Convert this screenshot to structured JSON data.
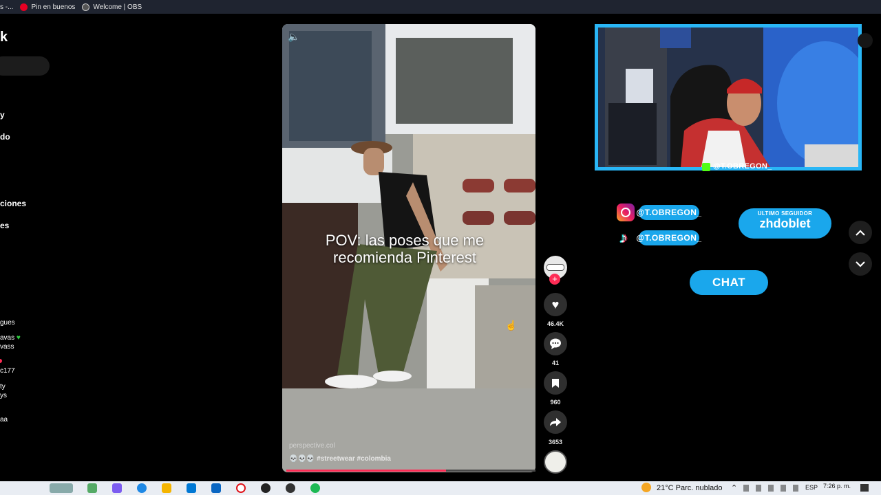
{
  "bookmarks": [
    {
      "label": "s -...",
      "icon": "tab-fragment-icon"
    },
    {
      "label": "Pin en buenos",
      "icon": "pinterest-icon"
    },
    {
      "label": "Welcome | OBS",
      "icon": "obs-icon"
    }
  ],
  "sidebar": {
    "logo_fragment": "k",
    "items": [
      "y",
      "do",
      "ciones",
      "es"
    ],
    "following": [
      "gues",
      "avas",
      "vass",
      "c177",
      "ty",
      "ys",
      "aa"
    ]
  },
  "video": {
    "caption_line1": "POV: las poses que me",
    "caption_line2": "recomienda Pinterest",
    "author": "perspective.col",
    "hashtags": "💀💀💀 #streetwear #colombia",
    "progress": 0.64
  },
  "actions": {
    "likes": "46.4K",
    "comments": "41",
    "saves": "960",
    "shares": "3653"
  },
  "stream": {
    "cam_handle": "@T.OBREGON_",
    "instagram_handle": "@T.OBREGON_",
    "tiktok_handle": "@T.OBREGON_",
    "follower_title": "ULTIMO SEGUIDOR",
    "follower_name": "zhdoblet",
    "chat_label": "CHAT",
    "accent": "#1aa7ec"
  },
  "taskbar": {
    "weather": "21°C  Parc. nublado",
    "lang": "ESP",
    "time": "7:26 p. m."
  },
  "colors": {
    "tiktok_red": "#fe2c55",
    "like_count": "#e8e8e8"
  }
}
